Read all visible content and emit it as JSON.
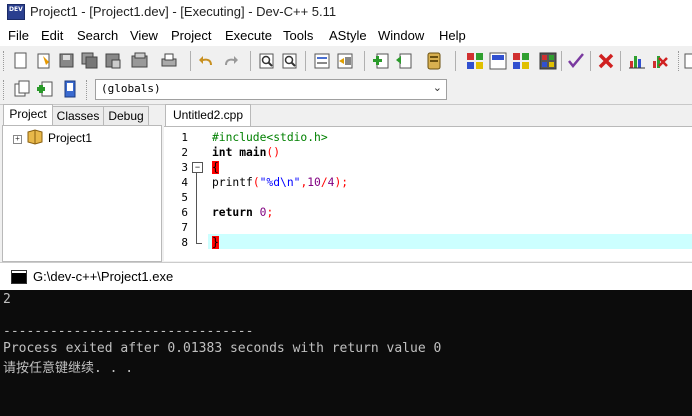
{
  "window": {
    "title": "Project1 - [Project1.dev] - [Executing] - Dev-C++ 5.11",
    "icon": "dev-cpp-icon",
    "icon_text": "DEV"
  },
  "menu": [
    "File",
    "Edit",
    "Search",
    "View",
    "Project",
    "Execute",
    "Tools",
    "AStyle",
    "Window",
    "Help"
  ],
  "toolbar2": {
    "scope_select": "(globals)"
  },
  "left_panel": {
    "tabs": [
      "Project",
      "Classes",
      "Debug"
    ],
    "tree_item": "Project1"
  },
  "editor": {
    "tab": "Untitled2.cpp",
    "line_numbers": [
      "1",
      "2",
      "3",
      "4",
      "5",
      "6",
      "7",
      "8"
    ],
    "lines": {
      "l1": "#include<stdio.h>",
      "l2_kw": "int",
      "l2_rest": " main",
      "l2_parens": "()",
      "l3": "{",
      "l4_fn": "printf",
      "l4_open": "(",
      "l4_str": "\"%d\\n\"",
      "l4_comma": ",",
      "l4_n1": "10",
      "l4_div": "/",
      "l4_n2": "4",
      "l4_close": ");",
      "l6_kw": "return",
      "l6_num": "0",
      "l6_semi": ";",
      "l8": "}"
    }
  },
  "console": {
    "title": "G:\\dev-c++\\Project1.exe",
    "output": "2",
    "separator": "--------------------------------",
    "exit_message": "Process exited after 0.01383 seconds with return value 0",
    "prompt": "请按任意键继续. . ."
  }
}
